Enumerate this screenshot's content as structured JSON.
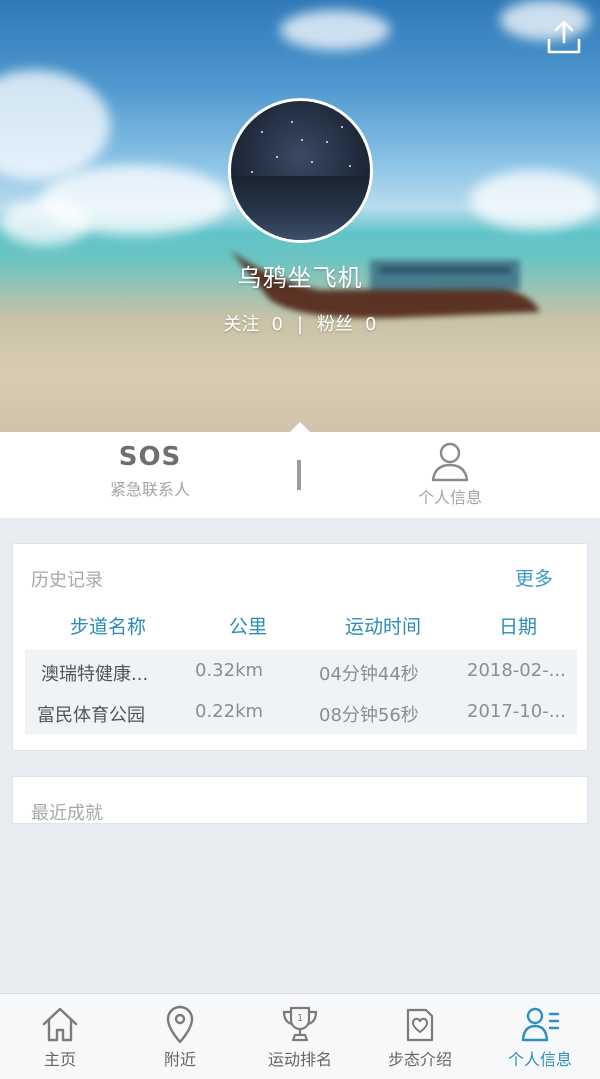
{
  "profile": {
    "username": "乌鸦坐飞机",
    "follow_label": "关注",
    "follow_count": "0",
    "separator": "|",
    "fans_label": "粉丝",
    "fans_count": "0"
  },
  "actions": {
    "sos_title": "SOS",
    "sos_subtitle": "紧急联系人",
    "profile_label": "个人信息"
  },
  "history": {
    "title": "历史记录",
    "more": "更多",
    "columns": [
      "步道名称",
      "公里",
      "运动时间",
      "日期"
    ],
    "rows": [
      [
        "澳瑞特健康...",
        "0.32km",
        "04分钟44秒",
        "2018-02-..."
      ],
      [
        "富民体育公园",
        "0.22km",
        "08分钟56秒",
        "2017-10-..."
      ]
    ]
  },
  "achievements": {
    "title": "最近成就"
  },
  "tabs": [
    {
      "label": "主页",
      "icon": "home-icon"
    },
    {
      "label": "附近",
      "icon": "location-pin-icon"
    },
    {
      "label": "运动排名",
      "icon": "trophy-icon"
    },
    {
      "label": "步态介绍",
      "icon": "heart-card-icon"
    },
    {
      "label": "个人信息",
      "icon": "person-list-icon"
    }
  ],
  "colors": {
    "accent": "#2d8fc0",
    "header_text": "#3a9ac9"
  }
}
